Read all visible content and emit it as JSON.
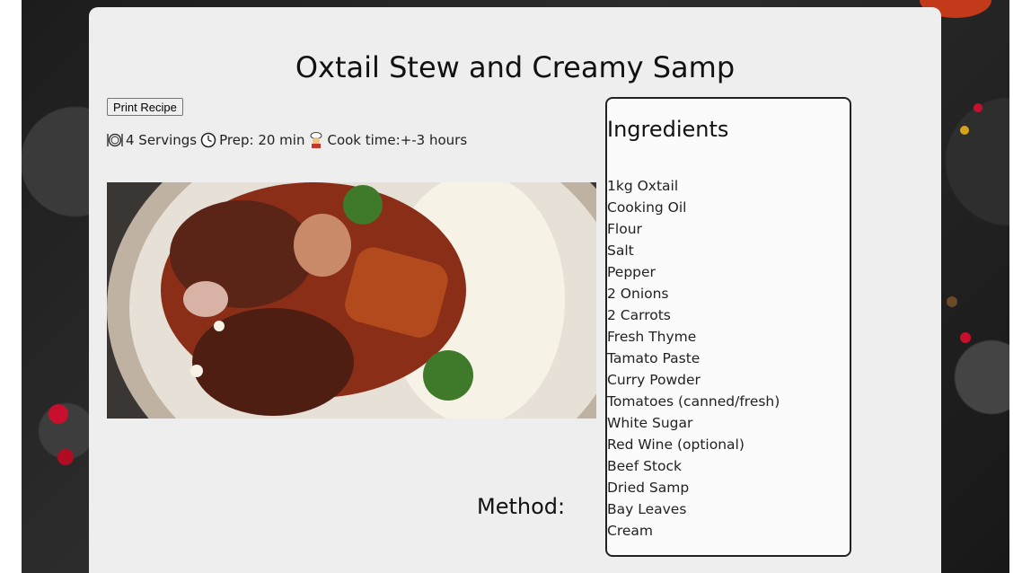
{
  "recipe": {
    "title": "Oxtail Stew and Creamy Samp",
    "print_label": "Print Recipe",
    "servings": "4 Servings",
    "prep": "Prep: 20 min",
    "cook": "Cook time:+-3 hours",
    "method_heading": "Method:"
  },
  "ingredients": {
    "heading": "Ingredients",
    "items": [
      "1kg Oxtail",
      "Cooking Oil",
      "Flour",
      "Salt",
      "Pepper",
      "2 Onions",
      "2 Carrots",
      "Fresh Thyme",
      "Tamato Paste",
      "Curry Powder",
      "Tomatoes (canned/fresh)",
      "White Sugar",
      "Red Wine (optional)",
      "Beef Stock",
      "Dried Samp",
      "Bay Leaves",
      "Cream"
    ]
  },
  "icons": {
    "servings": "plate-cutlery-icon",
    "prep": "clock-icon",
    "cook": "chef-icon"
  }
}
